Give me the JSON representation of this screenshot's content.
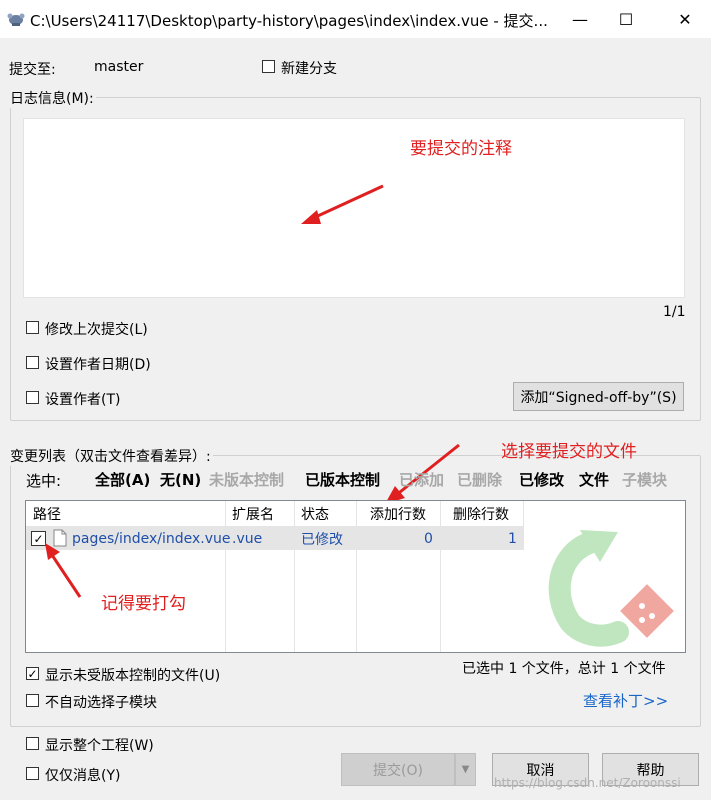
{
  "window": {
    "title": "C:\\Users\\24117\\Desktop\\party-history\\pages\\index\\index.vue - 提交...",
    "minimize": "—",
    "maximize": "☐",
    "close": "✕"
  },
  "commit_to": {
    "label": "提交至:",
    "branch": "master",
    "new_branch_label": "新建分支"
  },
  "log": {
    "group_label": "日志信息(M):",
    "message": "",
    "counter": "1/1"
  },
  "options": {
    "amend": "修改上次提交(L)",
    "set_author_date": "设置作者日期(D)",
    "set_author": "设置作者(T)",
    "signed_off_button": "添加“Signed-off-by”(S)"
  },
  "changes": {
    "group_label": "变更列表（双击文件查看差异）:",
    "select_label": "选中:",
    "filters": [
      {
        "label": "全部(A)",
        "enabled": true
      },
      {
        "label": "无(N)",
        "enabled": true
      },
      {
        "label": "未版本控制",
        "enabled": false
      },
      {
        "label": "已版本控制",
        "enabled": true
      },
      {
        "label": "已添加",
        "enabled": false
      },
      {
        "label": "已删除",
        "enabled": false
      },
      {
        "label": "已修改",
        "enabled": true
      },
      {
        "label": "文件",
        "enabled": true
      },
      {
        "label": "子模块",
        "enabled": false
      }
    ],
    "columns": [
      "路径",
      "扩展名",
      "状态",
      "添加行数",
      "删除行数"
    ],
    "rows": [
      {
        "path": "pages/index/index.vue",
        "ext": ".vue",
        "status": "已修改",
        "added": "0",
        "deleted": "1",
        "checked": true
      }
    ],
    "show_unversioned": "显示未受版本控制的文件(U)",
    "no_auto_submodules": "不自动选择子模块",
    "summary": "已选中 1 个文件，总计 1 个文件",
    "view_patch": "查看补丁>>"
  },
  "bottom": {
    "show_whole_project": "显示整个工程(W)",
    "message_only": "仅仅消息(Y)",
    "commit_button": "提交(O)",
    "cancel_button": "取消",
    "help_button": "帮助",
    "watermark": "https://blog.csdn.net/Zoroonssi"
  },
  "annotations": {
    "commit_note": "要提交的注释",
    "choose_files": "选择要提交的文件",
    "remember_check": "记得要打勾"
  },
  "colors": {
    "annotation": "#e02020",
    "link": "#1a66c8",
    "file_text": "#1f4fa8"
  }
}
